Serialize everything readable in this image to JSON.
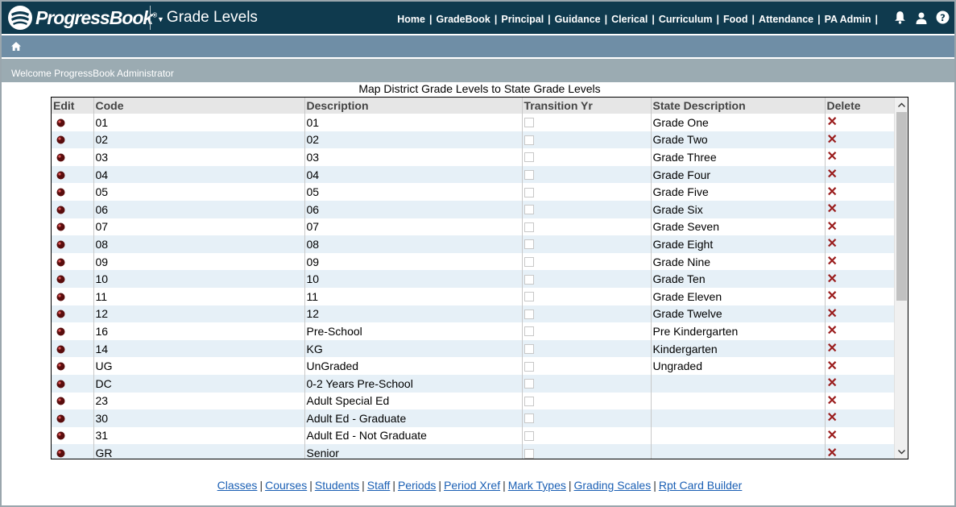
{
  "app": {
    "logo_text": "ProgressBook",
    "logo_mark": "®",
    "module_title": "Grade Levels"
  },
  "nav": [
    "Home",
    "GradeBook",
    "Principal",
    "Guidance",
    "Clerical",
    "Curriculum",
    "Food",
    "Attendance",
    "PA Admin"
  ],
  "icons": {
    "notifications": "bell-icon",
    "user": "user-icon",
    "help": "help-icon",
    "home": "home-icon"
  },
  "welcome": "Welcome ProgressBook Administrator",
  "page_title": "Map District Grade Levels to State Grade Levels",
  "table": {
    "columns": [
      "Edit",
      "Code",
      "Description",
      "Transition Yr",
      "State Description",
      "Delete"
    ],
    "rows": [
      {
        "code": "01",
        "description": "01",
        "state": "Grade One",
        "transition": false
      },
      {
        "code": "02",
        "description": "02",
        "state": "Grade Two",
        "transition": false
      },
      {
        "code": "03",
        "description": "03",
        "state": "Grade Three",
        "transition": false
      },
      {
        "code": "04",
        "description": "04",
        "state": "Grade Four",
        "transition": false
      },
      {
        "code": "05",
        "description": "05",
        "state": "Grade Five",
        "transition": false
      },
      {
        "code": "06",
        "description": "06",
        "state": "Grade Six",
        "transition": false
      },
      {
        "code": "07",
        "description": "07",
        "state": "Grade Seven",
        "transition": false
      },
      {
        "code": "08",
        "description": "08",
        "state": "Grade Eight",
        "transition": false
      },
      {
        "code": "09",
        "description": "09",
        "state": "Grade Nine",
        "transition": false
      },
      {
        "code": "10",
        "description": "10",
        "state": "Grade Ten",
        "transition": false
      },
      {
        "code": "11",
        "description": "11",
        "state": "Grade Eleven",
        "transition": false
      },
      {
        "code": "12",
        "description": "12",
        "state": "Grade Twelve",
        "transition": false
      },
      {
        "code": "16",
        "description": "Pre-School",
        "state": "Pre Kindergarten",
        "transition": false
      },
      {
        "code": "14",
        "description": "KG",
        "state": "Kindergarten",
        "transition": false
      },
      {
        "code": "UG",
        "description": "UnGraded",
        "state": "Ungraded",
        "transition": false
      },
      {
        "code": "DC",
        "description": "0-2 Years Pre-School",
        "state": "",
        "transition": false
      },
      {
        "code": "23",
        "description": "Adult Special Ed",
        "state": "",
        "transition": false
      },
      {
        "code": "30",
        "description": "Adult Ed - Graduate",
        "state": "",
        "transition": false
      },
      {
        "code": "31",
        "description": "Adult Ed - Not Graduate",
        "state": "",
        "transition": false
      },
      {
        "code": "GR",
        "description": "Senior",
        "state": "",
        "transition": false
      }
    ]
  },
  "footer_links": [
    "Classes",
    "Courses",
    "Students",
    "Staff",
    "Periods",
    "Period Xref",
    "Mark Types",
    "Grading Scales",
    "Rpt Card Builder"
  ],
  "colors": {
    "topbar": "#0f3a4e",
    "crumbbar": "#6f8ea6",
    "welcomebar": "#9babb2",
    "row_alt": "#e6f0f7",
    "delete": "#9a1c1c",
    "link": "#1a5fb4"
  }
}
